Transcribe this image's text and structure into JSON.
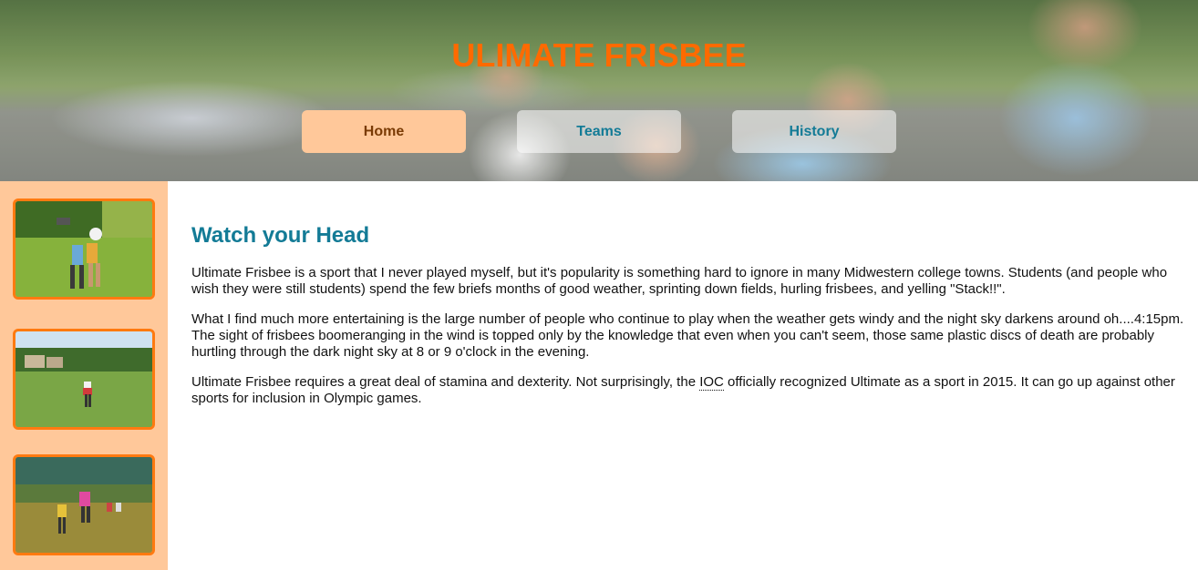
{
  "header": {
    "title": "ULIMATE FRISBEE"
  },
  "nav": {
    "items": [
      {
        "label": "Home",
        "active": true
      },
      {
        "label": "Teams",
        "active": false
      },
      {
        "label": "History",
        "active": false
      }
    ]
  },
  "sidebar": {
    "thumbnails": [
      {
        "alt": "frisbee-players-catching"
      },
      {
        "alt": "frisbee-player-in-field"
      },
      {
        "alt": "frisbee-players-jumping"
      }
    ]
  },
  "main": {
    "heading": "Watch your Head",
    "paragraph1": "Ultimate Frisbee is a sport that I never played myself, but it's popularity is something hard to ignore in many Midwestern college towns. Students (and people who wish they were still students) spend the few briefs months of good weather, sprinting down fields, hurling frisbees, and yelling \"Stack!!\".",
    "paragraph2": "What I find much more entertaining is the large number of people who continue to play when the weather gets windy and the night sky darkens around oh....4:15pm. The sight of frisbees boomeranging in the wind is topped only by the knowledge that even when you can't seem, those same plastic discs of death are probably hurtling through the dark night sky at 8 or 9 o'clock in the evening.",
    "paragraph3_before": "Ultimate Frisbee requires a great deal of stamina and dexterity. Not surprisingly, the ",
    "paragraph3_abbr": "IOC",
    "paragraph3_after": " officially recognized Ultimate as a sport in 2015. It can go up against other sports for inclusion in Olympic games."
  },
  "colors": {
    "title": "#ff6a00",
    "nav_active_bg": "#ffc89a",
    "nav_text": "#137b96",
    "sidebar_bg": "#ffc89a",
    "thumb_border": "#ff7a10",
    "heading": "#137b96"
  }
}
